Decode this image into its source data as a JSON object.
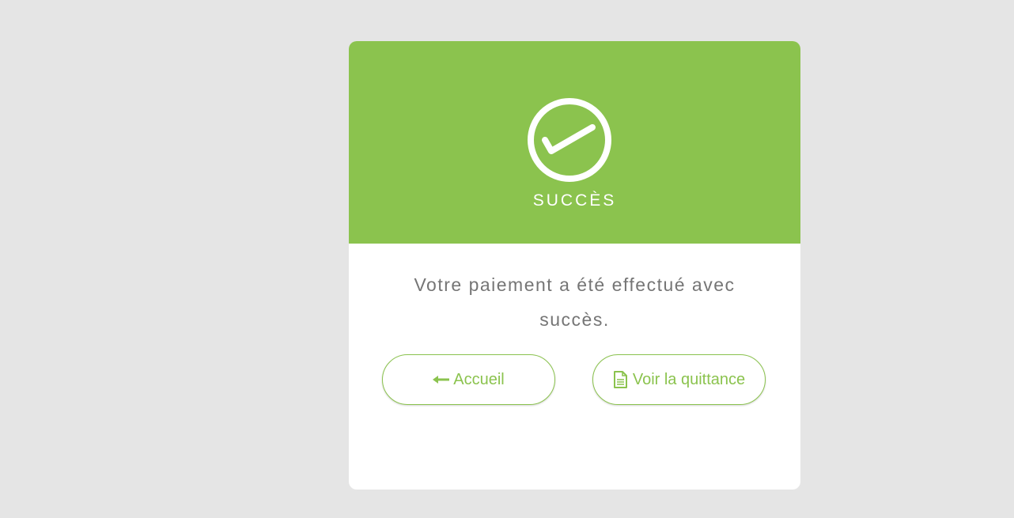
{
  "status": {
    "title": "SUCCÈS",
    "icon": "check-circle-icon",
    "color": "#8bc34e"
  },
  "message": "Votre paiement a été effectué avec succès.",
  "buttons": {
    "home": {
      "icon": "arrow-left-icon",
      "label": "Accueil"
    },
    "receipt": {
      "icon": "document-icon",
      "label": "Voir la quittance",
      "highlight_color": "#ffff00"
    }
  }
}
